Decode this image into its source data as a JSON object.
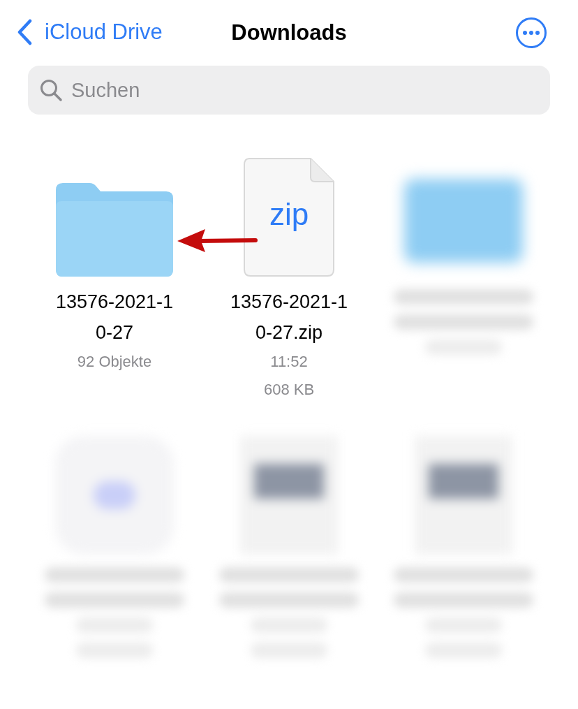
{
  "nav": {
    "back_label": "iCloud Drive",
    "title": "Downloads"
  },
  "search": {
    "placeholder": "Suchen"
  },
  "items": [
    {
      "kind": "folder",
      "name": "13576-2021-10-27",
      "details": [
        "92 Objekte"
      ]
    },
    {
      "kind": "zip",
      "icon_label": "zip",
      "name": "13576-2021-10-27.zip",
      "details": [
        "11:52",
        "608 KB"
      ]
    },
    {
      "kind": "blurred_folder"
    },
    {
      "kind": "blurred_app"
    },
    {
      "kind": "blurred_document"
    },
    {
      "kind": "blurred_document"
    }
  ],
  "annotation": {
    "kind": "arrow"
  }
}
